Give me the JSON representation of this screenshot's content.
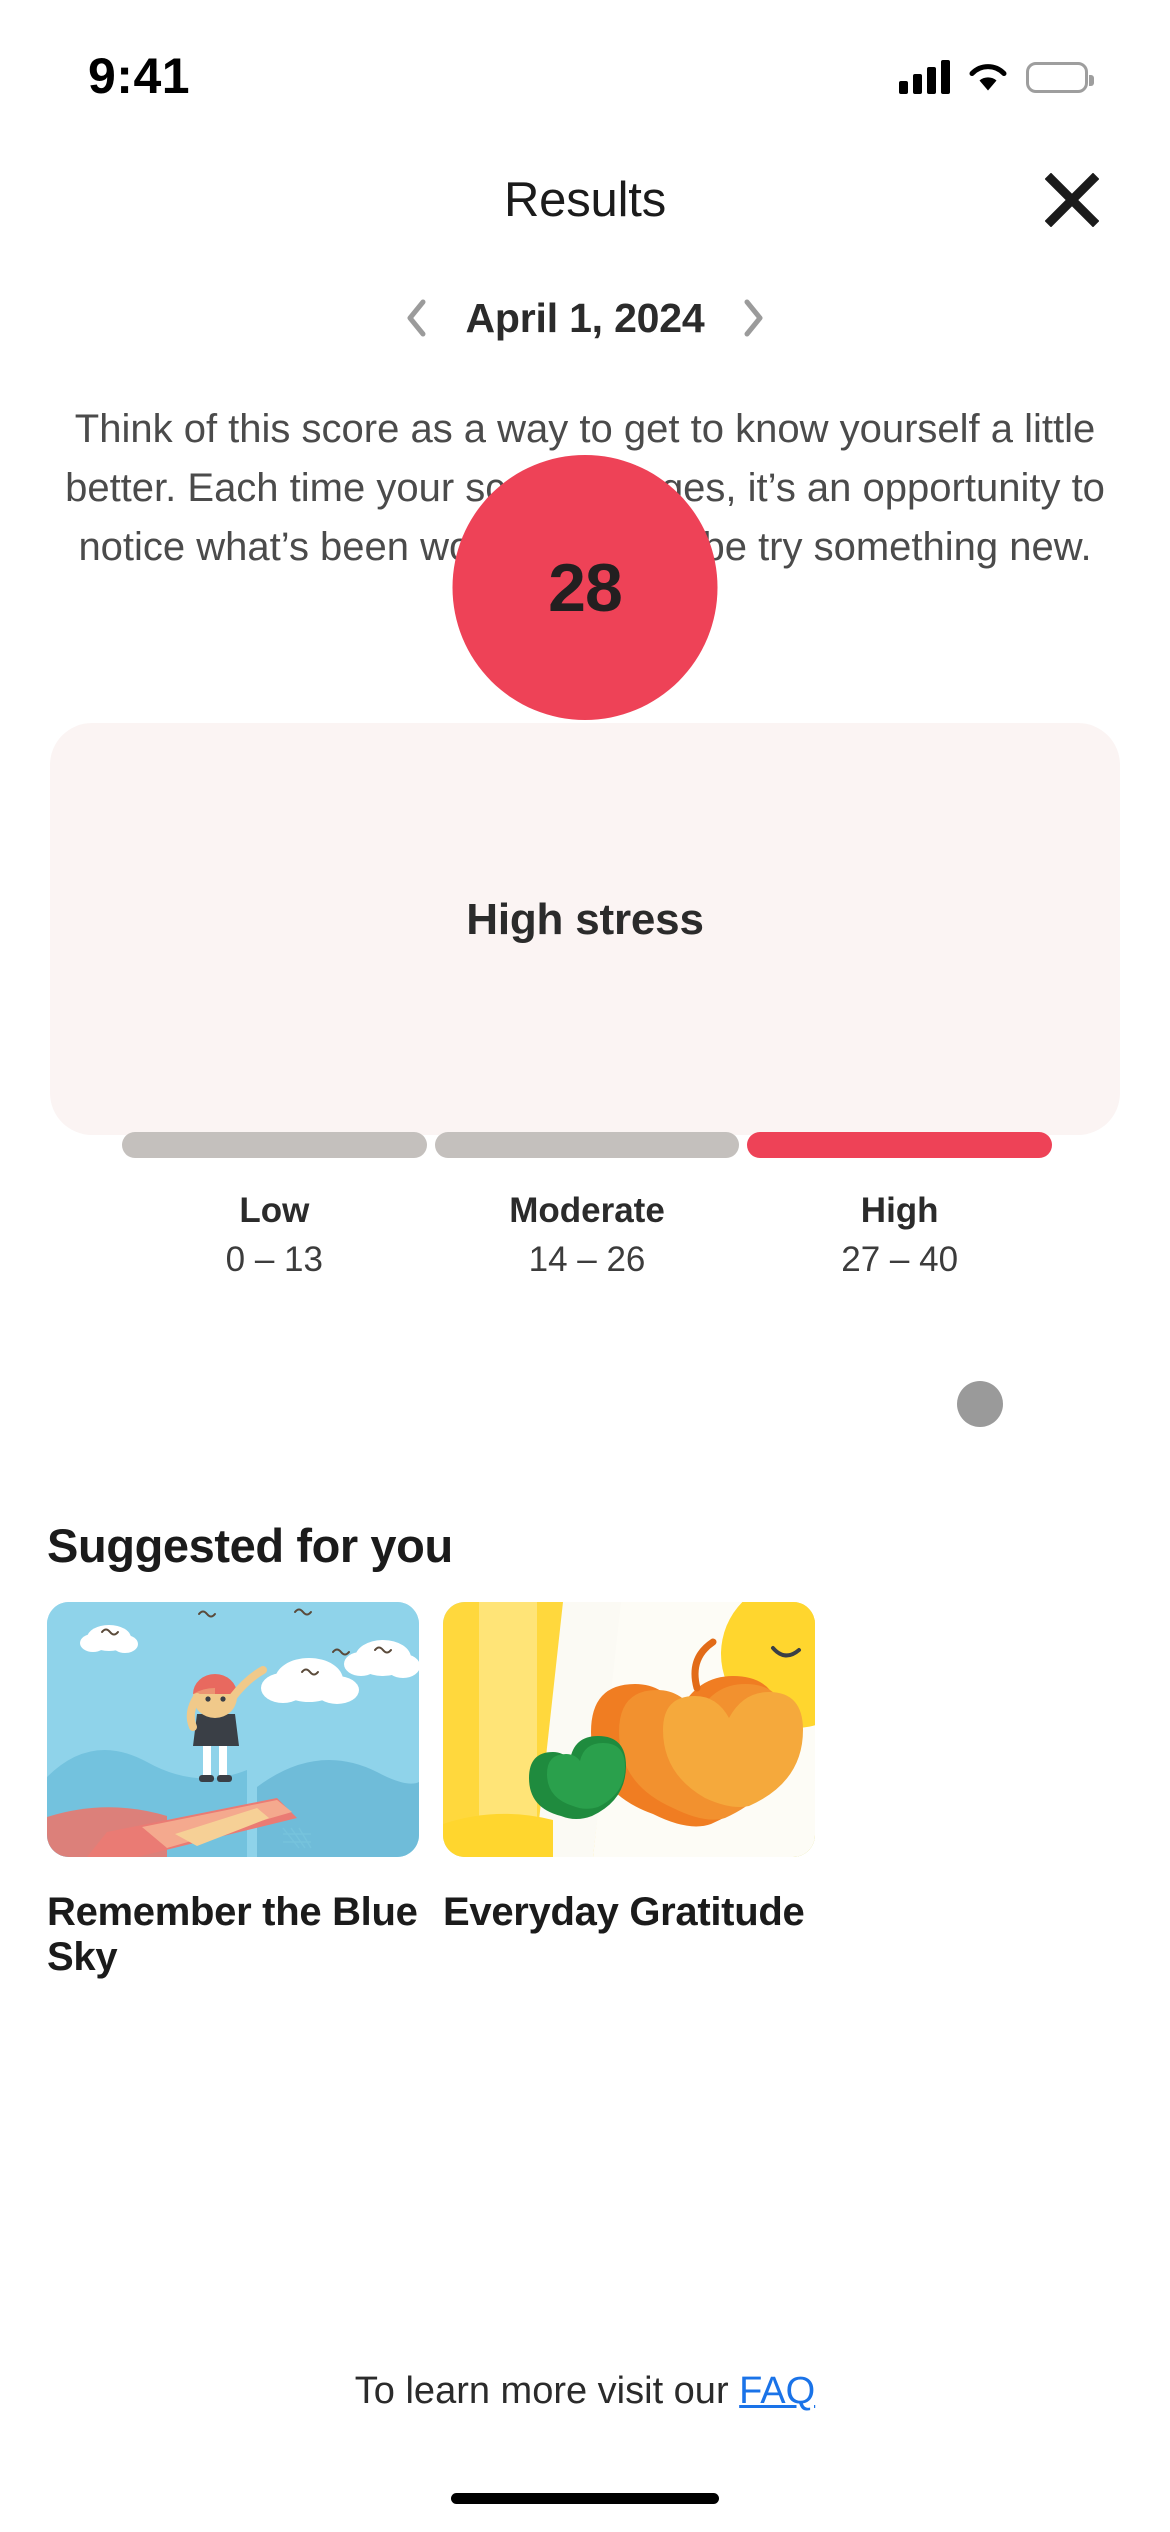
{
  "status_bar": {
    "time": "9:41",
    "cellular_icon": "signal-bars-icon",
    "wifi_icon": "wifi-icon",
    "battery_icon": "battery-icon"
  },
  "header": {
    "title": "Results",
    "close_icon": "close-icon"
  },
  "date_nav": {
    "prev_icon": "chevron-left-icon",
    "next_icon": "chevron-right-icon",
    "date": "April 1, 2024"
  },
  "intro": {
    "paragraph": "Think of this score as a way to get to know yourself a little better. Each time your score changes, it’s an opportunity to notice what’s been working, or maybe try something new."
  },
  "score_card": {
    "score": "28",
    "level": "High stress",
    "accent_color": "#ee4257",
    "card_background": "#fbf4f3",
    "inactive_color": "#c4c0bd",
    "segments": [
      {
        "name": "Low",
        "range": "0 – 13",
        "active": false
      },
      {
        "name": "Moderate",
        "range": "14 – 26",
        "active": false
      },
      {
        "name": "High",
        "range": "27 – 40",
        "active": true
      }
    ],
    "pager_dot": "page-indicator-dot"
  },
  "suggested": {
    "title": "Suggested for you",
    "items": [
      {
        "label": "Remember the Blue Sky",
        "thumbnail": "blue-sky-illustration"
      },
      {
        "label": "Everyday Gratitude",
        "thumbnail": "gratitude-fruit-illustration"
      }
    ]
  },
  "footer": {
    "text_before": "To learn more visit our ",
    "link_label": "FAQ",
    "link_color": "#1a73e8"
  }
}
